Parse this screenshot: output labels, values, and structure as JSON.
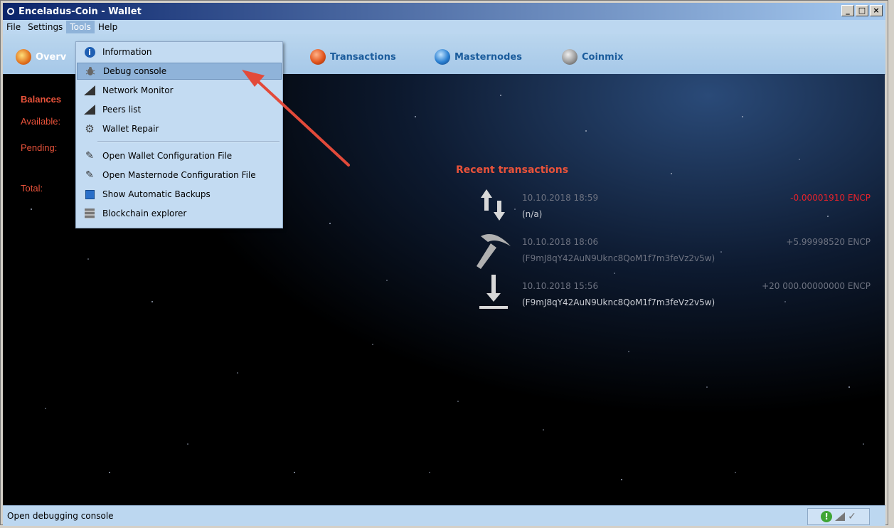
{
  "window": {
    "title": "Enceladus-Coin - Wallet",
    "controls": [
      "_",
      "□",
      "×"
    ]
  },
  "menubar": {
    "items": [
      "File",
      "Settings",
      "Tools",
      "Help"
    ],
    "active": "Tools"
  },
  "toolbar": {
    "overview_label": "Overv",
    "transactions_label": "Transactions",
    "masternodes_label": "Masternodes",
    "coinmix_label": "Coinmix"
  },
  "balances": {
    "heading": "Balances",
    "available_label": "Available:",
    "pending_label": "Pending:",
    "total_label": "Total:"
  },
  "tools_menu": {
    "items": [
      {
        "label": "Information",
        "icon": "info-icon"
      },
      {
        "label": "Debug console",
        "icon": "bug-icon"
      },
      {
        "label": "Network Monitor",
        "icon": "signal-icon"
      },
      {
        "label": "Peers list",
        "icon": "signal-icon"
      },
      {
        "label": "Wallet Repair",
        "icon": "gear-icon"
      },
      {
        "label": "Open Wallet Configuration File",
        "icon": "pencil-icon"
      },
      {
        "label": "Open Masternode Configuration File",
        "icon": "pencil-icon"
      },
      {
        "label": "Show Automatic Backups",
        "icon": "floppy-icon"
      },
      {
        "label": "Blockchain explorer",
        "icon": "server-icon"
      }
    ],
    "selected": "Debug console"
  },
  "recent": {
    "title": "Recent transactions",
    "transactions": [
      {
        "date": "10.10.2018 18:59",
        "address": "(n/a)",
        "amount": "-0.00001910 ENCP",
        "icon": "transfer-arrows-icon",
        "amount_color": "#e8222a"
      },
      {
        "date": "10.10.2018 18:06",
        "address": "(F9mJ8qY42AuN9Uknc8QoM1f7m3feVz2v5w)",
        "amount": "+5.99998520 ENCP",
        "icon": "pickaxe-icon",
        "amount_color": "#6d7280"
      },
      {
        "date": "10.10.2018 15:56",
        "address": "(F9mJ8qY42AuN9Uknc8QoM1f7m3feVz2v5w)",
        "amount": "+20 000.00000000 ENCP",
        "icon": "receive-icon",
        "amount_color": "#6d7280"
      }
    ]
  },
  "statusbar": {
    "message": "Open debugging console"
  },
  "colors": {
    "accent_red": "#e8523a",
    "menu_highlight": "#8fb3d9",
    "toolbar_text": "#1b5c9c"
  }
}
